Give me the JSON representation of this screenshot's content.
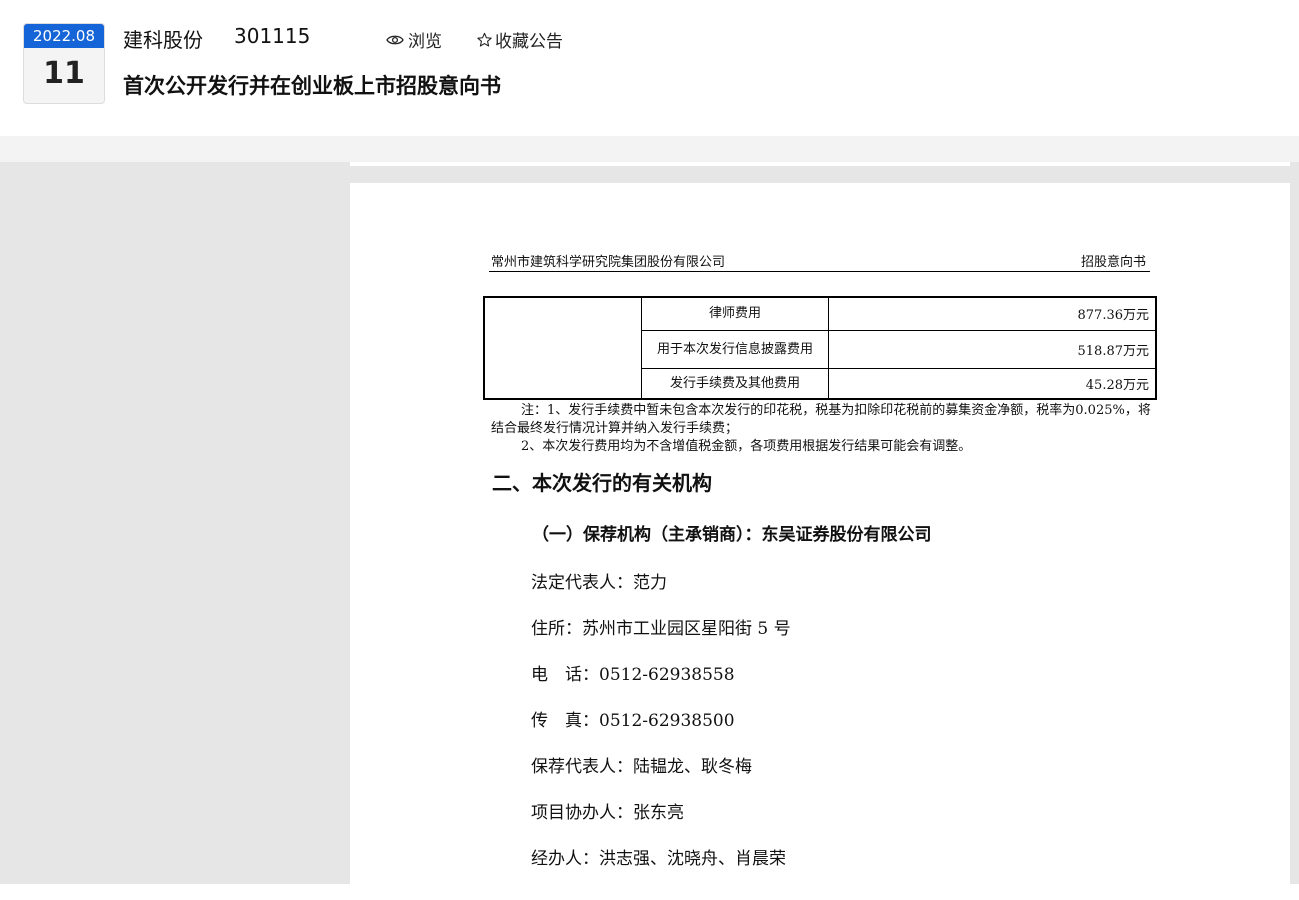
{
  "header": {
    "date_ym": "2022.08",
    "date_day": "11",
    "company_name": "建科股份",
    "stock_code": "301115",
    "browse_label": "浏览",
    "favorite_label": "收藏公告",
    "notice_title": "首次公开发行并在创业板上市招股意向书"
  },
  "document": {
    "header_left": "常州市建筑科学研究院集团股份有限公司",
    "header_right": "招股意向书",
    "fee_table": {
      "rows": [
        {
          "item": "律师费用",
          "amount": "877.36万元"
        },
        {
          "item": "用于本次发行信息披露费用",
          "amount": "518.87万元"
        },
        {
          "item": "发行手续费及其他费用",
          "amount": "45.28万元"
        }
      ]
    },
    "note_line1": "注：1、发行手续费中暂未包含本次发行的印花税，税基为扣除印花税前的募集资金净额，税率为0.025%，将结合最终发行情况计算并纳入发行手续费；",
    "note_line2": "2、本次发行费用均为不含增值税金额，各项费用根据发行结果可能会有调整。",
    "section_heading": "二、本次发行的有关机构",
    "sub_heading": "（一）保荐机构（主承销商）：东吴证券股份有限公司",
    "info_lines": [
      "法定代表人：范力",
      "住所：苏州市工业园区星阳街 5 号",
      "电　话：0512-62938558",
      "传　真：0512-62938500",
      "保荐代表人：陆韫龙、耿冬梅",
      "项目协办人：张东亮",
      "经办人：洪志强、沈晓舟、肖晨荣"
    ]
  },
  "colors": {
    "badge_blue": "#1565d8",
    "viewer_bg": "#e6e6e6"
  },
  "icons": [
    "eye-icon",
    "star-icon"
  ]
}
